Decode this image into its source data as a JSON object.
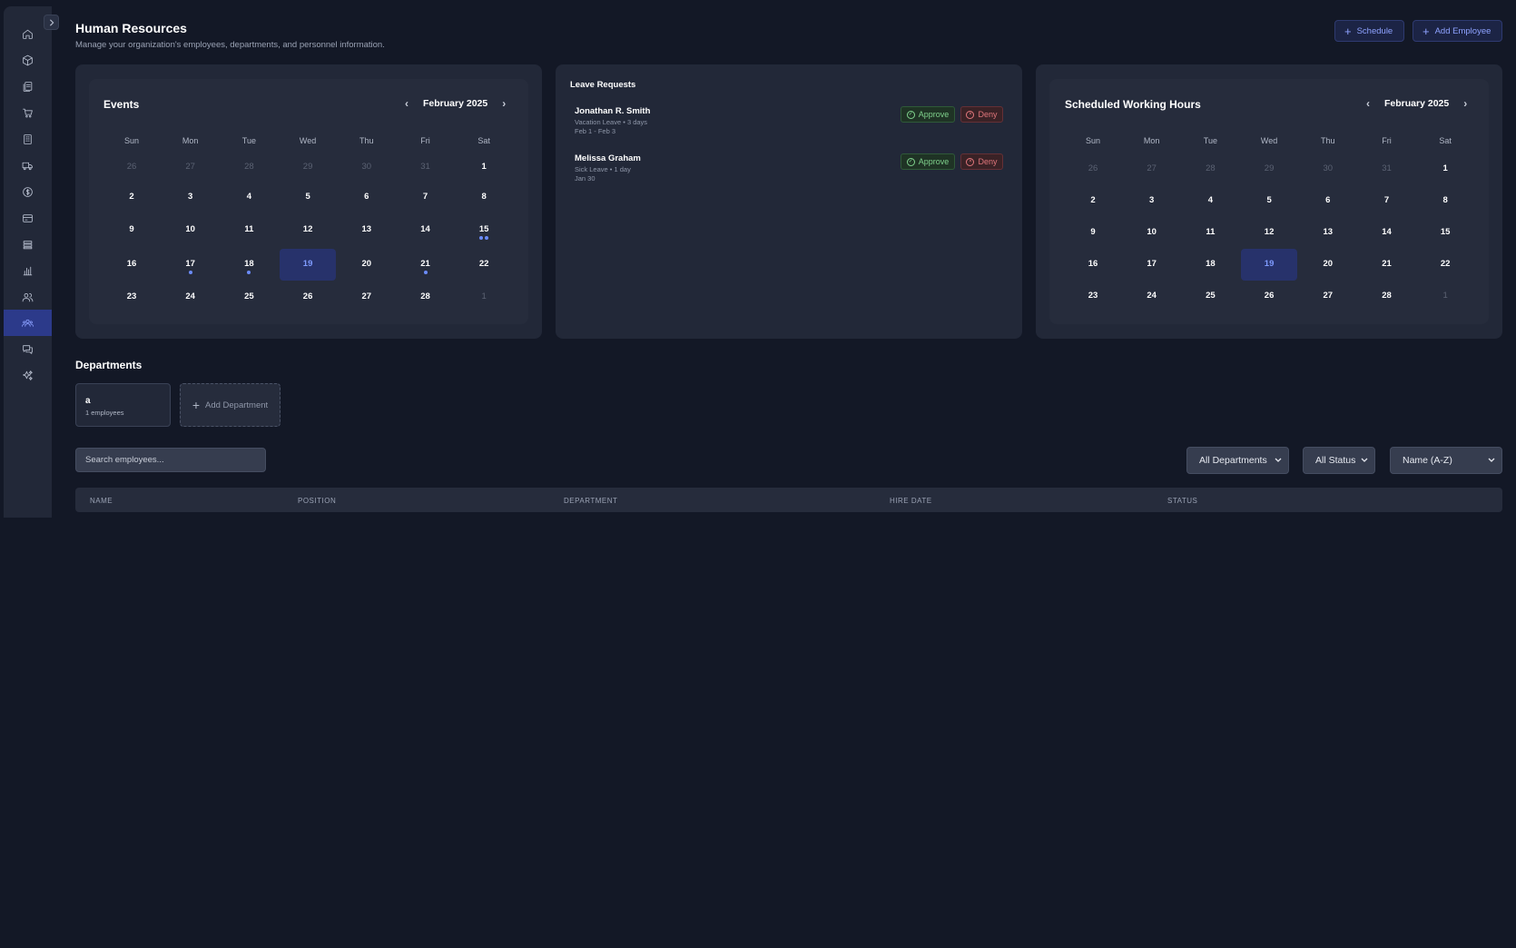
{
  "header": {
    "title": "Human Resources",
    "subtitle": "Manage your organization's employees, departments, and personnel information.",
    "schedule_label": "Schedule",
    "add_employee_label": "Add Employee"
  },
  "sidebar": {
    "items": [
      {
        "icon": "home-icon"
      },
      {
        "icon": "box-icon"
      },
      {
        "icon": "documents-icon"
      },
      {
        "icon": "cart-icon"
      },
      {
        "icon": "building-icon"
      },
      {
        "icon": "truck-icon"
      },
      {
        "icon": "dollar-icon"
      },
      {
        "icon": "credit-card-icon"
      },
      {
        "icon": "database-icon"
      },
      {
        "icon": "bar-chart-icon"
      },
      {
        "icon": "users-icon"
      },
      {
        "icon": "team-icon",
        "active": true
      },
      {
        "icon": "chat-icon"
      },
      {
        "icon": "sparkles-icon"
      }
    ]
  },
  "events": {
    "title": "Events",
    "month": "February 2025",
    "weekdays": [
      "Sun",
      "Mon",
      "Tue",
      "Wed",
      "Thu",
      "Fri",
      "Sat"
    ],
    "weeks": [
      [
        "26",
        "27",
        "28",
        "29",
        "30",
        "31",
        "1"
      ],
      [
        "2",
        "3",
        "4",
        "5",
        "6",
        "7",
        "8"
      ],
      [
        "9",
        "10",
        "11",
        "12",
        "13",
        "14",
        "15"
      ],
      [
        "16",
        "17",
        "18",
        "19",
        "20",
        "21",
        "22"
      ],
      [
        "23",
        "24",
        "25",
        "26",
        "27",
        "28",
        "1"
      ]
    ],
    "today": "19",
    "event_dots": {
      "15": 2,
      "17": 1,
      "18": 1,
      "21": 1
    }
  },
  "leave_requests": {
    "title": "Leave Requests",
    "approve_label": "Approve",
    "deny_label": "Deny",
    "items": [
      {
        "name": "Jonathan R. Smith",
        "type": "Vacation Leave • 3 days",
        "dates": "Feb 1 - Feb 3"
      },
      {
        "name": "Melissa Graham",
        "type": "Sick Leave • 1 day",
        "dates": "Jan 30"
      }
    ]
  },
  "working_hours": {
    "title": "Scheduled Working Hours",
    "month": "February 2025",
    "weekdays": [
      "Sun",
      "Mon",
      "Tue",
      "Wed",
      "Thu",
      "Fri",
      "Sat"
    ],
    "weeks": [
      [
        "26",
        "27",
        "28",
        "29",
        "30",
        "31",
        "1"
      ],
      [
        "2",
        "3",
        "4",
        "5",
        "6",
        "7",
        "8"
      ],
      [
        "9",
        "10",
        "11",
        "12",
        "13",
        "14",
        "15"
      ],
      [
        "16",
        "17",
        "18",
        "19",
        "20",
        "21",
        "22"
      ],
      [
        "23",
        "24",
        "25",
        "26",
        "27",
        "28",
        "1"
      ]
    ],
    "today": "19"
  },
  "departments": {
    "title": "Departments",
    "items": [
      {
        "name": "a",
        "count": "1 employees"
      }
    ],
    "add_label": "Add Department"
  },
  "filters": {
    "search_placeholder": "Search employees...",
    "department": "All Departments",
    "status": "All Status",
    "sort": "Name (A-Z)"
  },
  "table": {
    "columns": [
      "NAME",
      "POSITION",
      "DEPARTMENT",
      "HIRE DATE",
      "STATUS"
    ]
  },
  "colors": {
    "background": "#131826",
    "panel": "#222838",
    "accent": "#8ea2ff",
    "approve": "#7fd18c",
    "deny": "#e0767b"
  }
}
